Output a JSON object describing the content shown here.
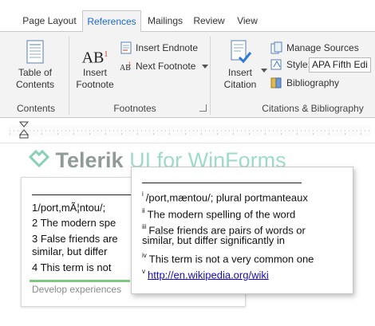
{
  "tabs": [
    {
      "label": "Page Layout",
      "active": false
    },
    {
      "label": "References",
      "active": true
    },
    {
      "label": "Mailings",
      "active": false
    },
    {
      "label": "Review",
      "active": false
    },
    {
      "label": "View",
      "active": false
    }
  ],
  "ribbon": {
    "contents": {
      "toc_label_line1": "Table of",
      "toc_label_line2": "Contents",
      "group_label": "Contents"
    },
    "footnotes": {
      "insert_footnote_line1": "Insert",
      "insert_footnote_line2": "Footnote",
      "insert_endnote": "Insert Endnote",
      "next_footnote": "Next Footnote",
      "group_label": "Footnotes"
    },
    "citations": {
      "insert_citation_line1": "Insert",
      "insert_citation_line2": "Citation",
      "manage_sources": "Manage Sources",
      "style_label": "Style:",
      "style_value": "APA Fifth Edi",
      "bibliography": "Bibliography",
      "group_label": "Citations & Bibliography"
    }
  },
  "watermark": {
    "brand": "Telerik",
    "product": "UI for WinForms"
  },
  "document": {
    "footnotes": [
      "1/port,mÃ¦ntou/;",
      "2 The modern spe",
      "3 False friends are",
      "similar, but differ",
      "4 This term is not"
    ],
    "footer_text": "Develop experiences"
  },
  "popup": {
    "items": [
      {
        "marker": "i",
        "text": "/port,mæntou/; plural portmanteaux"
      },
      {
        "marker": "ii",
        "text": "The modern spelling of the word"
      },
      {
        "marker": "iii",
        "text": "False friends are pairs of words or"
      },
      {
        "marker": "",
        "text": "similar, but differ significantly in"
      },
      {
        "marker": "iv",
        "text": "This term is not a very common one"
      },
      {
        "marker": "v",
        "text": "http://en.wikipedia.org/wiki"
      }
    ]
  },
  "colors": {
    "accent": "#1b6ac9",
    "ribbon_bg": "#f3f3f3",
    "brand_green": "#7fd0b8",
    "link": "#1a0dab"
  }
}
